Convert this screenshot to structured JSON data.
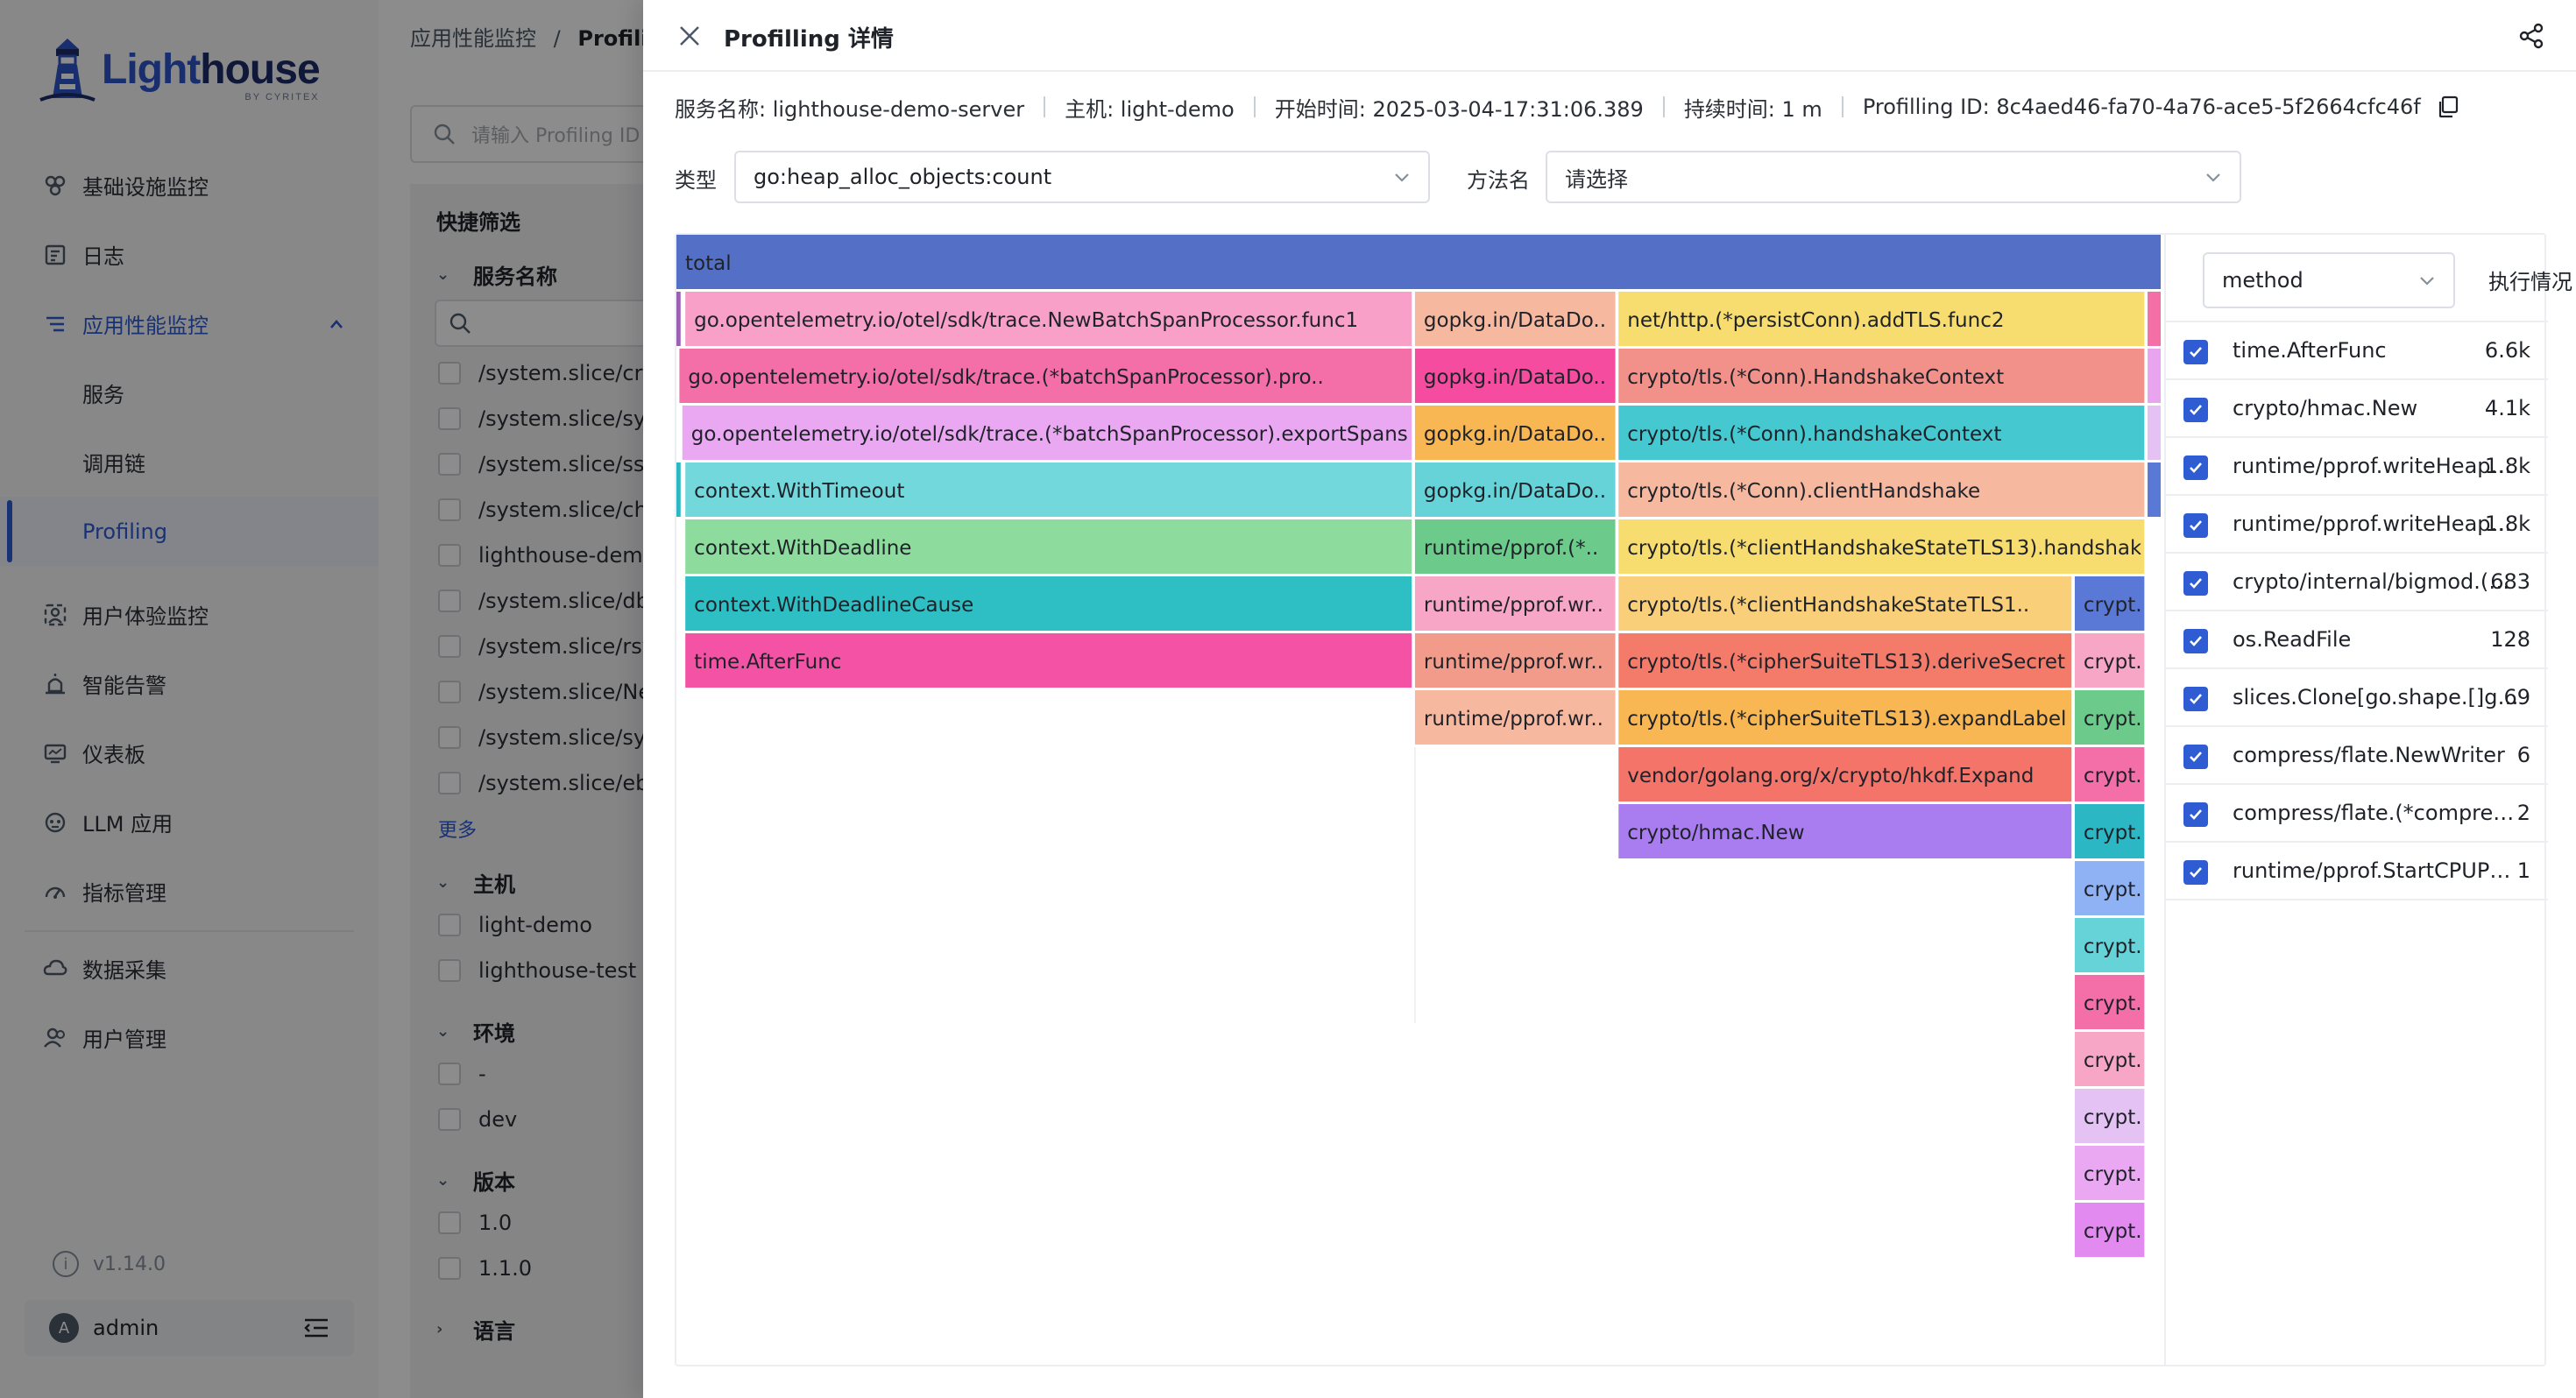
{
  "brand": {
    "name_part1": "Light",
    "name_part2": "house",
    "sub": "BY CYRITEX"
  },
  "sidebar": {
    "items": [
      {
        "label": "基础设施监控",
        "icon": "infrastructure-icon"
      },
      {
        "label": "日志",
        "icon": "log-icon"
      },
      {
        "label": "应用性能监控",
        "icon": "apm-icon",
        "expanded": true,
        "children": [
          {
            "label": "服务"
          },
          {
            "label": "调用链"
          },
          {
            "label": "Profiling",
            "selected": true
          }
        ]
      },
      {
        "label": "用户体验监控",
        "icon": "user-experience-icon"
      },
      {
        "label": "智能告警",
        "icon": "alert-icon"
      },
      {
        "label": "仪表板",
        "icon": "dashboard-icon"
      },
      {
        "label": "LLM 应用",
        "icon": "llm-icon"
      },
      {
        "label": "指标管理",
        "icon": "metrics-icon"
      },
      {
        "label": "数据采集",
        "icon": "data-collection-icon"
      },
      {
        "label": "用户管理",
        "icon": "user-management-icon"
      }
    ],
    "version": "v1.14.0",
    "user": "admin",
    "avatar_letter": "A"
  },
  "background": {
    "breadcrumb_root": "应用性能监控",
    "breadcrumb_sep": "/",
    "breadcrumb_current": "Profilin",
    "search_placeholder": "请输入 Profiling ID",
    "quick_filter": "快捷筛选",
    "groups": {
      "service": "服务名称",
      "host": "主机",
      "env": "环境",
      "version": "版本",
      "language": "语言"
    },
    "services": [
      "/system.slice/cro",
      "/system.slice/sys",
      "/system.slice/ssh",
      "/system.slice/chr",
      "lighthouse-demo",
      "/system.slice/dbu",
      "/system.slice/rsys",
      "/system.slice/Net",
      "/system.slice/syst",
      "/system.slice/ebp"
    ],
    "more": "更多",
    "hosts": [
      "light-demo",
      "lighthouse-test"
    ],
    "envs": [
      "-",
      "dev"
    ],
    "versions": [
      "1.0",
      "1.1.0"
    ]
  },
  "drawer": {
    "title": "Profilling 详情",
    "meta": {
      "service": "服务名称: lighthouse-demo-server",
      "host": "主机: light-demo",
      "start": "开始时间: 2025-03-04-17:31:06.389",
      "duration": "持续时间: 1 m",
      "profiling_id": "Profilling ID: 8c4aed46-fa70-4a76-ace5-5f2664cfc46f"
    },
    "type_label": "类型",
    "type_value": "go:heap_alloc_objects:count",
    "method_label": "方法名",
    "method_placeholder": "请选择",
    "side_select": "method",
    "side_exec": "执行情况",
    "method_list": [
      {
        "name": "time.AfterFunc",
        "value": "6.6k"
      },
      {
        "name": "crypto/hmac.New",
        "value": "4.1k"
      },
      {
        "name": "runtime/pprof.writeHeap…",
        "value": "1.8k"
      },
      {
        "name": "runtime/pprof.writeHeap…",
        "value": "1.8k"
      },
      {
        "name": "crypto/internal/bigmod.(…",
        "value": "683"
      },
      {
        "name": "os.ReadFile",
        "value": "128"
      },
      {
        "name": "slices.Clone[go.shape.[]g…",
        "value": "69"
      },
      {
        "name": "compress/flate.NewWriter",
        "value": "6"
      },
      {
        "name": "compress/flate.(*compre…",
        "value": "2"
      },
      {
        "name": "runtime/pprof.StartCPUP…",
        "value": "1"
      }
    ],
    "flame": [
      {
        "label": "total",
        "level": 0,
        "start": 0,
        "end": 1,
        "color": "#5470c6",
        "text": "#1f2329"
      },
      {
        "label": "",
        "level": 1,
        "start": 0,
        "end": 0.004,
        "color": "#9a60b4"
      },
      {
        "label": "go.opentelemetry.io/otel/sdk/trace.NewBatchSpanProcessor.func1",
        "level": 1,
        "start": 0.006,
        "end": 0.496,
        "color": "#f8a0c8"
      },
      {
        "label": "gopkg.in/DataDo..",
        "level": 1,
        "start": 0.497,
        "end": 0.633,
        "color": "#f7b8a0"
      },
      {
        "label": "net/http.(*persistConn).addTLS.func2",
        "level": 1,
        "start": 0.634,
        "end": 0.989,
        "color": "#f7dc6f"
      },
      {
        "label": "",
        "level": 1,
        "start": 0.99,
        "end": 1.0,
        "color": "#f56fa7"
      },
      {
        "label": "go.opentelemetry.io/otel/sdk/trace.(*batchSpanProcessor).pro..",
        "level": 2,
        "start": 0.002,
        "end": 0.496,
        "color": "#f46fa8"
      },
      {
        "label": "gopkg.in/DataDo..",
        "level": 2,
        "start": 0.497,
        "end": 0.633,
        "color": "#f54ca0"
      },
      {
        "label": "crypto/tls.(*Conn).HandshakeContext",
        "level": 2,
        "start": 0.634,
        "end": 0.989,
        "color": "#f2918a"
      },
      {
        "label": "",
        "level": 2,
        "start": 0.99,
        "end": 1.0,
        "color": "#e9a4f0"
      },
      {
        "label": "go.opentelemetry.io/otel/sdk/trace.(*batchSpanProcessor).exportSpans",
        "level": 3,
        "start": 0.004,
        "end": 0.496,
        "color": "#eaa7f2"
      },
      {
        "label": "gopkg.in/DataDo..",
        "level": 3,
        "start": 0.497,
        "end": 0.633,
        "color": "#f8b753"
      },
      {
        "label": "crypto/tls.(*Conn).handshakeContext",
        "level": 3,
        "start": 0.634,
        "end": 0.989,
        "color": "#45c8d0"
      },
      {
        "label": "",
        "level": 3,
        "start": 0.99,
        "end": 1.0,
        "color": "#e4c2f3"
      },
      {
        "label": "",
        "level": 4,
        "start": 0.0,
        "end": 0.004,
        "color": "#2bb7c4"
      },
      {
        "label": "context.WithTimeout",
        "level": 4,
        "start": 0.006,
        "end": 0.496,
        "color": "#72d8dc"
      },
      {
        "label": "gopkg.in/DataDo..",
        "level": 4,
        "start": 0.497,
        "end": 0.633,
        "color": "#66d3d8"
      },
      {
        "label": "crypto/tls.(*Conn).clientHandshake",
        "level": 4,
        "start": 0.634,
        "end": 0.989,
        "color": "#f7b8a0"
      },
      {
        "label": "",
        "level": 4,
        "start": 0.99,
        "end": 1.0,
        "color": "#5a78d6"
      },
      {
        "label": "context.WithDeadline",
        "level": 5,
        "start": 0.006,
        "end": 0.496,
        "color": "#8ddc9d"
      },
      {
        "label": "runtime/pprof.(*..",
        "level": 5,
        "start": 0.497,
        "end": 0.633,
        "color": "#6ccb8a"
      },
      {
        "label": "crypto/tls.(*clientHandshakeStateTLS13).handshake",
        "level": 5,
        "start": 0.634,
        "end": 0.989,
        "color": "#f7dc6f"
      },
      {
        "label": "context.WithDeadlineCause",
        "level": 6,
        "start": 0.006,
        "end": 0.496,
        "color": "#2ebfc4"
      },
      {
        "label": "runtime/pprof.wr..",
        "level": 6,
        "start": 0.497,
        "end": 0.633,
        "color": "#f8a6c6"
      },
      {
        "label": "crypto/tls.(*clientHandshakeStateTLS1..",
        "level": 6,
        "start": 0.634,
        "end": 0.94,
        "color": "#f9cf7a"
      },
      {
        "label": "crypt..",
        "level": 6,
        "start": 0.941,
        "end": 0.989,
        "color": "#5a78d6"
      },
      {
        "label": "time.AfterFunc",
        "level": 7,
        "start": 0.006,
        "end": 0.496,
        "color": "#f452a4"
      },
      {
        "label": "runtime/pprof.wr..",
        "level": 7,
        "start": 0.497,
        "end": 0.633,
        "color": "#f29b8a"
      },
      {
        "label": "crypto/tls.(*cipherSuiteTLS13).deriveSecret",
        "level": 7,
        "start": 0.634,
        "end": 0.94,
        "color": "#f47a6a"
      },
      {
        "label": "crypt..",
        "level": 7,
        "start": 0.941,
        "end": 0.989,
        "color": "#f8a6c6"
      },
      {
        "label": "runtime/pprof.wr..",
        "level": 8,
        "start": 0.497,
        "end": 0.633,
        "color": "#f7b8a0"
      },
      {
        "label": "crypto/tls.(*cipherSuiteTLS13).expandLabel",
        "level": 8,
        "start": 0.634,
        "end": 0.94,
        "color": "#f8b753"
      },
      {
        "label": "crypt..",
        "level": 8,
        "start": 0.941,
        "end": 0.989,
        "color": "#6ccb8a"
      },
      {
        "label": "vendor/golang.org/x/crypto/hkdf.Expand",
        "level": 9,
        "start": 0.634,
        "end": 0.94,
        "color": "#f4746a"
      },
      {
        "label": "crypt..",
        "level": 9,
        "start": 0.941,
        "end": 0.989,
        "color": "#f46fa8"
      },
      {
        "label": "crypto/hmac.New",
        "level": 10,
        "start": 0.634,
        "end": 0.94,
        "color": "#a97df0"
      },
      {
        "label": "crypt..",
        "level": 10,
        "start": 0.941,
        "end": 0.989,
        "color": "#2bb7c4"
      },
      {
        "label": "crypt..",
        "level": 11,
        "start": 0.941,
        "end": 0.989,
        "color": "#8fb2f5"
      },
      {
        "label": "crypt..",
        "level": 12,
        "start": 0.941,
        "end": 0.989,
        "color": "#66d3d8"
      },
      {
        "label": "crypt..",
        "level": 13,
        "start": 0.941,
        "end": 0.989,
        "color": "#f46fa8"
      },
      {
        "label": "crypt..",
        "level": 14,
        "start": 0.941,
        "end": 0.989,
        "color": "#f8a6c6"
      },
      {
        "label": "crypt..",
        "level": 15,
        "start": 0.941,
        "end": 0.989,
        "color": "#e4c2f3"
      },
      {
        "label": "crypt..",
        "level": 16,
        "start": 0.941,
        "end": 0.989,
        "color": "#eaa7f2"
      },
      {
        "label": "crypt..",
        "level": 17,
        "start": 0.941,
        "end": 0.989,
        "color": "#e28af0"
      }
    ]
  },
  "colors": {
    "accent": "#2f5bd3",
    "overlay": "rgba(0,0,0,0.45)"
  }
}
